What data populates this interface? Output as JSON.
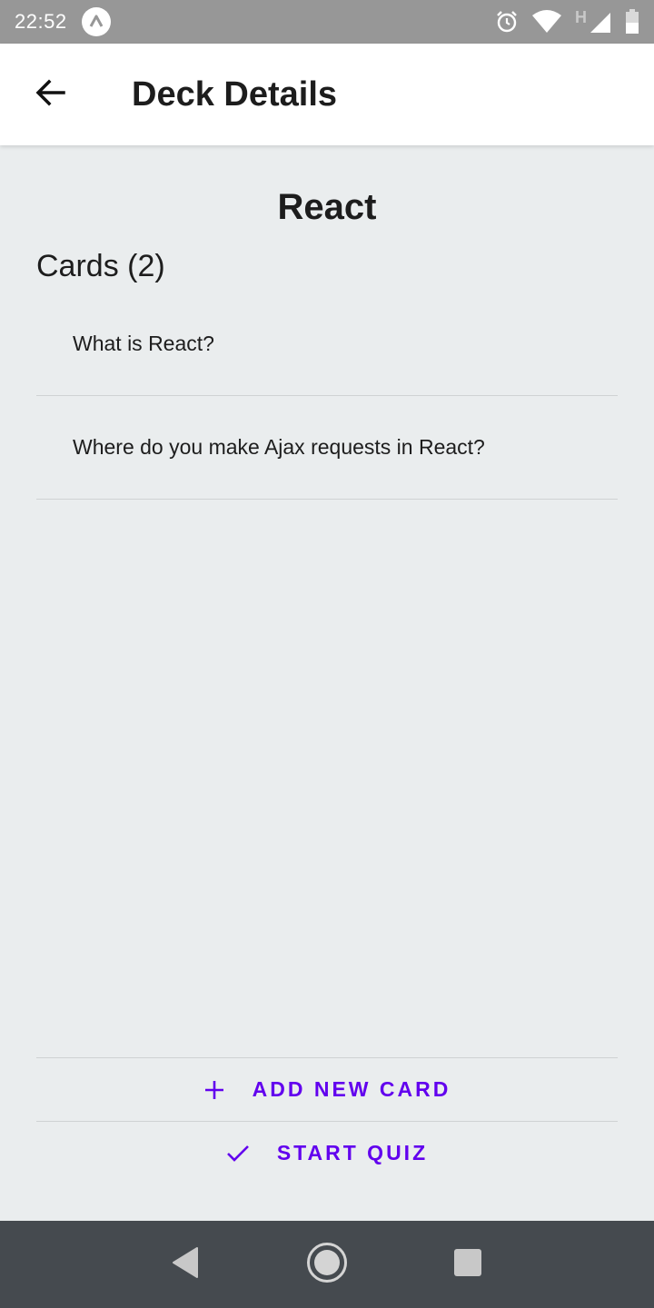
{
  "status_bar": {
    "time": "22:52",
    "network_type": "H"
  },
  "app_bar": {
    "title": "Deck Details"
  },
  "deck": {
    "title": "React",
    "cards_heading": "Cards (2)",
    "cards": [
      {
        "question": "What is React?"
      },
      {
        "question": "Where do you make Ajax requests in React?"
      }
    ]
  },
  "actions": {
    "add_label": "ADD NEW CARD",
    "quiz_label": "START QUIZ"
  },
  "colors": {
    "accent": "#6200ee",
    "background": "#eaedee",
    "status_bar": "#979797",
    "nav_bar": "#454a4f"
  },
  "icons": {
    "back": "arrow-left-icon",
    "add": "plus-icon",
    "quiz": "check-icon"
  }
}
